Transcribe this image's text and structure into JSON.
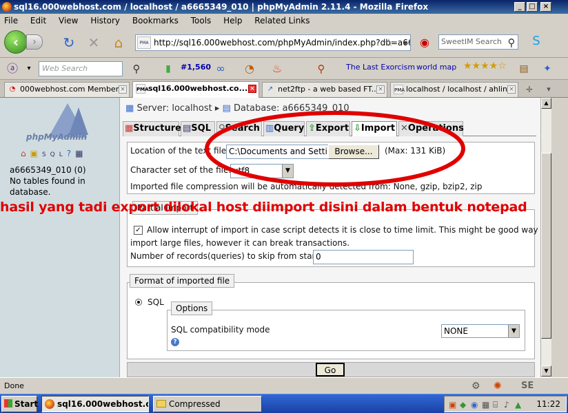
{
  "window": {
    "title": "sql16.000webhost.com / localhost / a6665349_010 | phpMyAdmin 2.11.4 - Mozilla Firefox"
  },
  "menu": [
    "File",
    "Edit",
    "View",
    "History",
    "Bookmarks",
    "Tools",
    "Help",
    "Related Links"
  ],
  "nav": {
    "url": "http://sql16.000webhost.com/phpMyAdmin/index.php?db=a666534",
    "search_placeholder": "SweetIM Search"
  },
  "toolbar2": {
    "web_search_placeholder": "Web Search",
    "counter": "#1,560",
    "link1": "The Last Exorcism",
    "link2": "world map"
  },
  "tabs": [
    {
      "label": "000webhost.com Member..."
    },
    {
      "label": "sql16.000webhost.co..."
    },
    {
      "label": "net2ftp - a web based FT..."
    },
    {
      "label": "localhost / localhost / ahlin..."
    }
  ],
  "sidebar": {
    "logo": "phpMyAdmin",
    "db_name": "a6665349_010 (0)",
    "no_tables_1": "No tables found in",
    "no_tables_2": "database."
  },
  "breadcrumb": {
    "server": "Server: localhost",
    "database": "Database: a6665349_010"
  },
  "pma_tabs": [
    "Structure",
    "SQL",
    "Search",
    "Query",
    "Export",
    "Import",
    "Operations"
  ],
  "import": {
    "location_label": "Location of the text file",
    "file_value": "C:\\Documents and Settin",
    "browse_label": "Browse...",
    "max_label": "(Max: 131 KiB)",
    "charset_label": "Character set of the file:",
    "charset_value": "utf8",
    "compression_note": "Imported file compression will be automatically detected from: None, gzip, bzip2, zip",
    "partial_legend": "Partial import",
    "allow_interrupt": "Allow interrupt of import in case script detects it is close to time limit. This might be good way to",
    "allow_interrupt_2": "import large files, however it can break transactions.",
    "skip_label": "Number of records(queries) to skip from start",
    "skip_value": "0",
    "format_legend": "Format of imported file",
    "sql_label": "SQL",
    "options_legend": "Options",
    "compat_label": "SQL compatibility mode",
    "compat_value": "NONE",
    "go_label": "Go"
  },
  "overlay_text": "hasil yang tadi export dilokal host diimport disini dalam bentuk notepad",
  "watermark": "phpMyAdmin",
  "status": {
    "text": "Done"
  },
  "taskbar": {
    "start": "Start",
    "task1": "sql16.000webhost.co...",
    "task2": "Compressed",
    "clock": "11:22"
  }
}
